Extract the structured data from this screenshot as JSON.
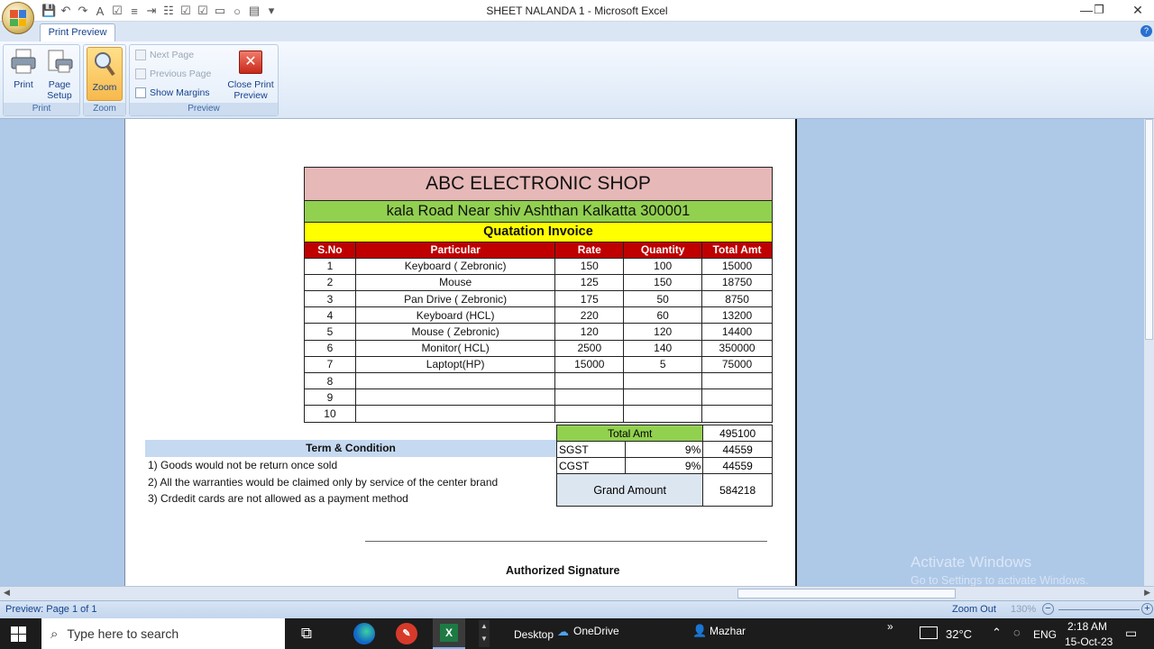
{
  "window": {
    "title": "SHEET NALANDA 1 - Microsoft Excel"
  },
  "ribbon": {
    "tab": "Print Preview",
    "print": {
      "print_label": "Print",
      "page_setup_label": "Page Setup",
      "group": "Print"
    },
    "zoom": {
      "zoom_label": "Zoom",
      "group": "Zoom"
    },
    "preview": {
      "next_page": "Next Page",
      "previous_page": "Previous Page",
      "show_margins": "Show Margins",
      "close_label": "Close Print Preview",
      "group": "Preview"
    }
  },
  "invoice": {
    "shop_name": "ABC ELECTRONIC SHOP",
    "address": "kala Road Near shiv Ashthan Kalkatta 300001",
    "heading": "Quatation Invoice",
    "columns": [
      "S.No",
      "Particular",
      "Rate",
      "Quantity",
      "Total Amt"
    ],
    "rows": [
      [
        "1",
        "Keyboard ( Zebronic)",
        "150",
        "100",
        "15000"
      ],
      [
        "2",
        "Mouse",
        "125",
        "150",
        "18750"
      ],
      [
        "3",
        "Pan Drive ( Zebronic)",
        "175",
        "50",
        "8750"
      ],
      [
        "4",
        "Keyboard (HCL)",
        "220",
        "60",
        "13200"
      ],
      [
        "5",
        "Mouse ( Zebronic)",
        "120",
        "120",
        "14400"
      ],
      [
        "6",
        "Monitor( HCL)",
        "2500",
        "140",
        "350000"
      ],
      [
        "7",
        "Laptopt(HP)",
        "15000",
        "5",
        "75000"
      ],
      [
        "8",
        "",
        "",
        "",
        ""
      ],
      [
        "9",
        "",
        "",
        "",
        ""
      ],
      [
        "10",
        "",
        "",
        "",
        ""
      ]
    ],
    "total_label": "Total Amt",
    "total_value": "495100",
    "sgst_label": "SGST",
    "sgst_rate": "9%",
    "sgst_value": "44559",
    "cgst_label": "CGST",
    "cgst_rate": "9%",
    "cgst_value": "44559",
    "grand_label": "Grand Amount",
    "grand_value": "584218"
  },
  "terms": {
    "heading": "Term & Condition",
    "lines": [
      "1) Goods would not be return once sold",
      "2) All the warranties would be claimed only by service of the center brand",
      "3) Crdedit cards are not allowed as a payment method"
    ]
  },
  "signature": "Authorized Signature",
  "watermark": {
    "line1": "Activate Windows",
    "line2": "Go to Settings to activate Windows."
  },
  "status": {
    "page": "Preview: Page 1 of 1",
    "zoom_out": "Zoom Out",
    "zoom_level": "130%"
  },
  "taskbar": {
    "search_placeholder": "Type here to search",
    "desktop": "Desktop",
    "onedrive": "OneDrive",
    "user": "Mazhar",
    "weather": "32°C",
    "lang": "ENG",
    "time": "2:18 AM",
    "date": "15-Oct-23"
  },
  "colors": {
    "shop_bg": "#e6b8b8",
    "address_bg": "#92d050",
    "heading_bg": "#ffff00",
    "header_bg": "#c00000",
    "terms_bg": "#c5d9f1"
  }
}
